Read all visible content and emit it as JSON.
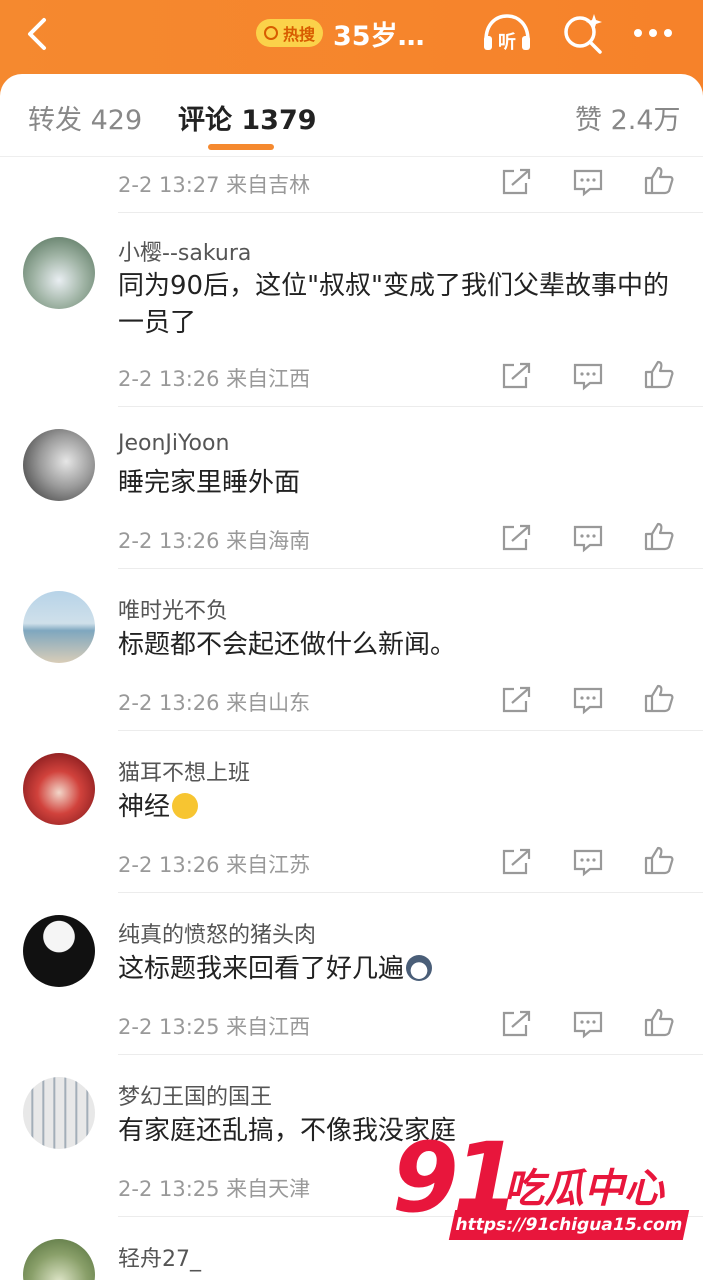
{
  "header": {
    "hot_badge": "热搜",
    "title": "35岁…",
    "listen_label": "听"
  },
  "tabs": [
    {
      "label": "转发 429"
    },
    {
      "label": "评论 1379"
    },
    {
      "label": "赞 2.4万"
    }
  ],
  "first_meta": "2-2 13:27 来自吉林",
  "comments": [
    {
      "user": "小樱--sakura",
      "text": "同为90后，这位\"叔叔\"变成了我们父辈故事中的一员了",
      "meta": "2-2 13:26 来自江西"
    },
    {
      "user": "JeonJiYoon",
      "text": "睡完家里睡外面",
      "meta": "2-2 13:26 来自海南"
    },
    {
      "user": "唯时光不负",
      "text": "标题都不会起还做什么新闻。",
      "meta": "2-2 13:26 来自山东"
    },
    {
      "user": "猫耳不想上班",
      "text": "神经",
      "meta": "2-2 13:26 来自江苏"
    },
    {
      "user": "纯真的愤怒的猪头肉",
      "text": "这标题我来回看了好几遍",
      "meta": "2-2 13:25 来自江西"
    },
    {
      "user": "梦幻王国的国王",
      "text": "有家庭还乱搞，不像我没家庭",
      "meta": "2-2 13:25 来自天津"
    },
    {
      "user": "轻舟27_",
      "text": "",
      "meta": ""
    }
  ],
  "watermark": {
    "number": "91",
    "name": "吃瓜中心",
    "url": "https://91chigua15.com"
  },
  "colors": {
    "accent": "#f5892f",
    "watermark": "#e8163c"
  }
}
